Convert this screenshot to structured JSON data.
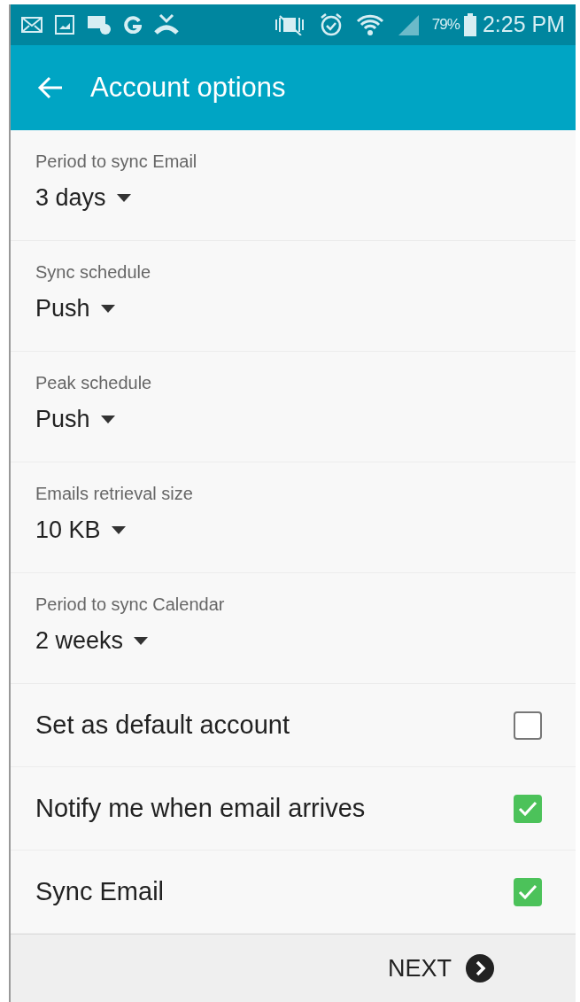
{
  "status_bar": {
    "battery": "79%",
    "time": "2:25 PM"
  },
  "app_bar": {
    "title": "Account options"
  },
  "settings": [
    {
      "kind": "dropdown",
      "label": "Period to sync Email",
      "value": "3 days"
    },
    {
      "kind": "dropdown",
      "label": "Sync schedule",
      "value": "Push"
    },
    {
      "kind": "dropdown",
      "label": "Peak schedule",
      "value": "Push"
    },
    {
      "kind": "dropdown",
      "label": "Emails retrieval size",
      "value": "10 KB"
    },
    {
      "kind": "dropdown",
      "label": "Period to sync Calendar",
      "value": "2 weeks"
    },
    {
      "kind": "checkbox",
      "label": "Set as default account",
      "checked": false
    },
    {
      "kind": "checkbox",
      "label": "Notify me when email arrives",
      "checked": true
    },
    {
      "kind": "checkbox",
      "label": "Sync Email",
      "checked": true
    }
  ],
  "footer": {
    "button": "NEXT"
  }
}
